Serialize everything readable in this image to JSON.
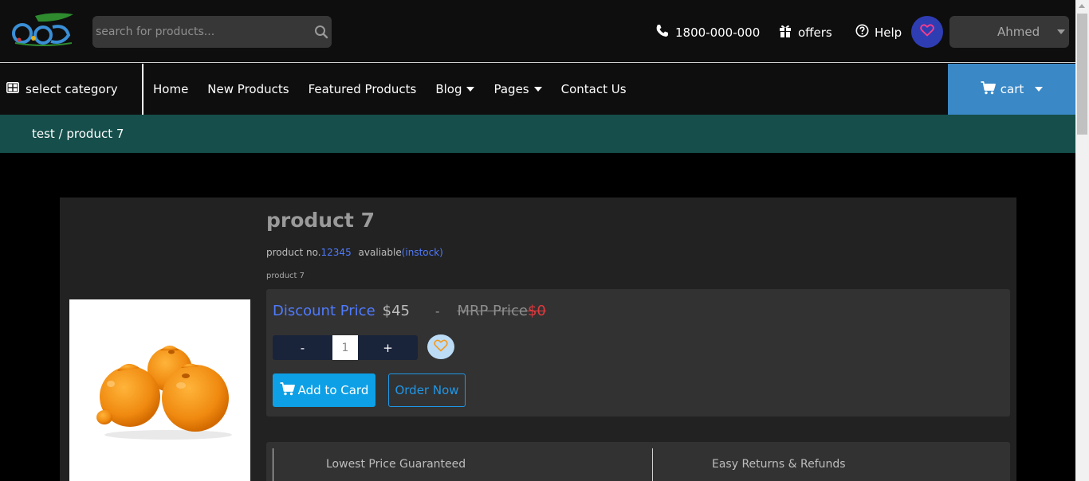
{
  "header": {
    "logo_alt": "store logo",
    "search": {
      "placeholder": "search for products..."
    },
    "phone": "1800-000-000",
    "offers": "offers",
    "help": "Help",
    "user": "Ahmed"
  },
  "nav": {
    "category": "select category",
    "links": [
      "Home",
      "New Products",
      "Featured Products",
      "Blog",
      "Pages",
      "Contact Us"
    ],
    "cart": "cart"
  },
  "breadcrumb": "test / product 7",
  "product": {
    "title": "product 7",
    "number_label": "product no.",
    "number": "12345",
    "availability_label": "avaliable",
    "availability": "(instock)",
    "description": "product 7",
    "discount_label": "Discount Price",
    "discount_value": "$45",
    "separator": "-",
    "mrp_label": "MRP Price",
    "mrp_value": "$0",
    "qty_minus": "-",
    "qty_value": "1",
    "qty_plus": "+",
    "add_to_card": "Add to Card",
    "order_now": "Order Now"
  },
  "features": [
    "Lowest Price Guaranteed",
    "Easy Returns & Refunds"
  ],
  "colors": {
    "topbar": "#0e0e0e",
    "breadcrumb_bg": "#154e4a",
    "cart_bg": "#3a88c6",
    "wishlist_bg": "#2f3db3",
    "accent_blue": "#4f7bff",
    "add_button": "#0da0e6",
    "mrp_red": "#e0393e"
  }
}
